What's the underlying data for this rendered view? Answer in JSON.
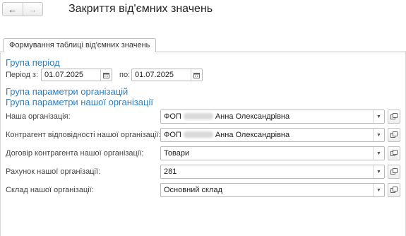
{
  "nav": {
    "back_icon": "←",
    "forward_icon": "→"
  },
  "window": {
    "title": "Закриття від'ємних значень"
  },
  "tab": {
    "label": "Формування таблиці від'ємних значень"
  },
  "period_group": {
    "title": "Група період",
    "from_label": "Період з:",
    "from_value": "01.07.2025",
    "to_label": "по:",
    "to_value": "01.07.2025"
  },
  "org_params_group": {
    "title": "Група параметри організацій"
  },
  "our_org_group": {
    "title": "Група параметри нашої організації",
    "fields": [
      {
        "label": "Наша організація:",
        "prefix": "ФОП",
        "suffix": "Анна Олександрівна"
      },
      {
        "label": "Контрагент відповідності нашої організації:",
        "prefix": "ФОП",
        "suffix": "Анна Олександрівна"
      },
      {
        "label": "Договір контрагента нашої організації:",
        "value": "Товари"
      },
      {
        "label": "Рахунок нашої організації:",
        "value": "281"
      },
      {
        "label": "Склад нашої організації:",
        "value": "Основний склад"
      }
    ]
  }
}
